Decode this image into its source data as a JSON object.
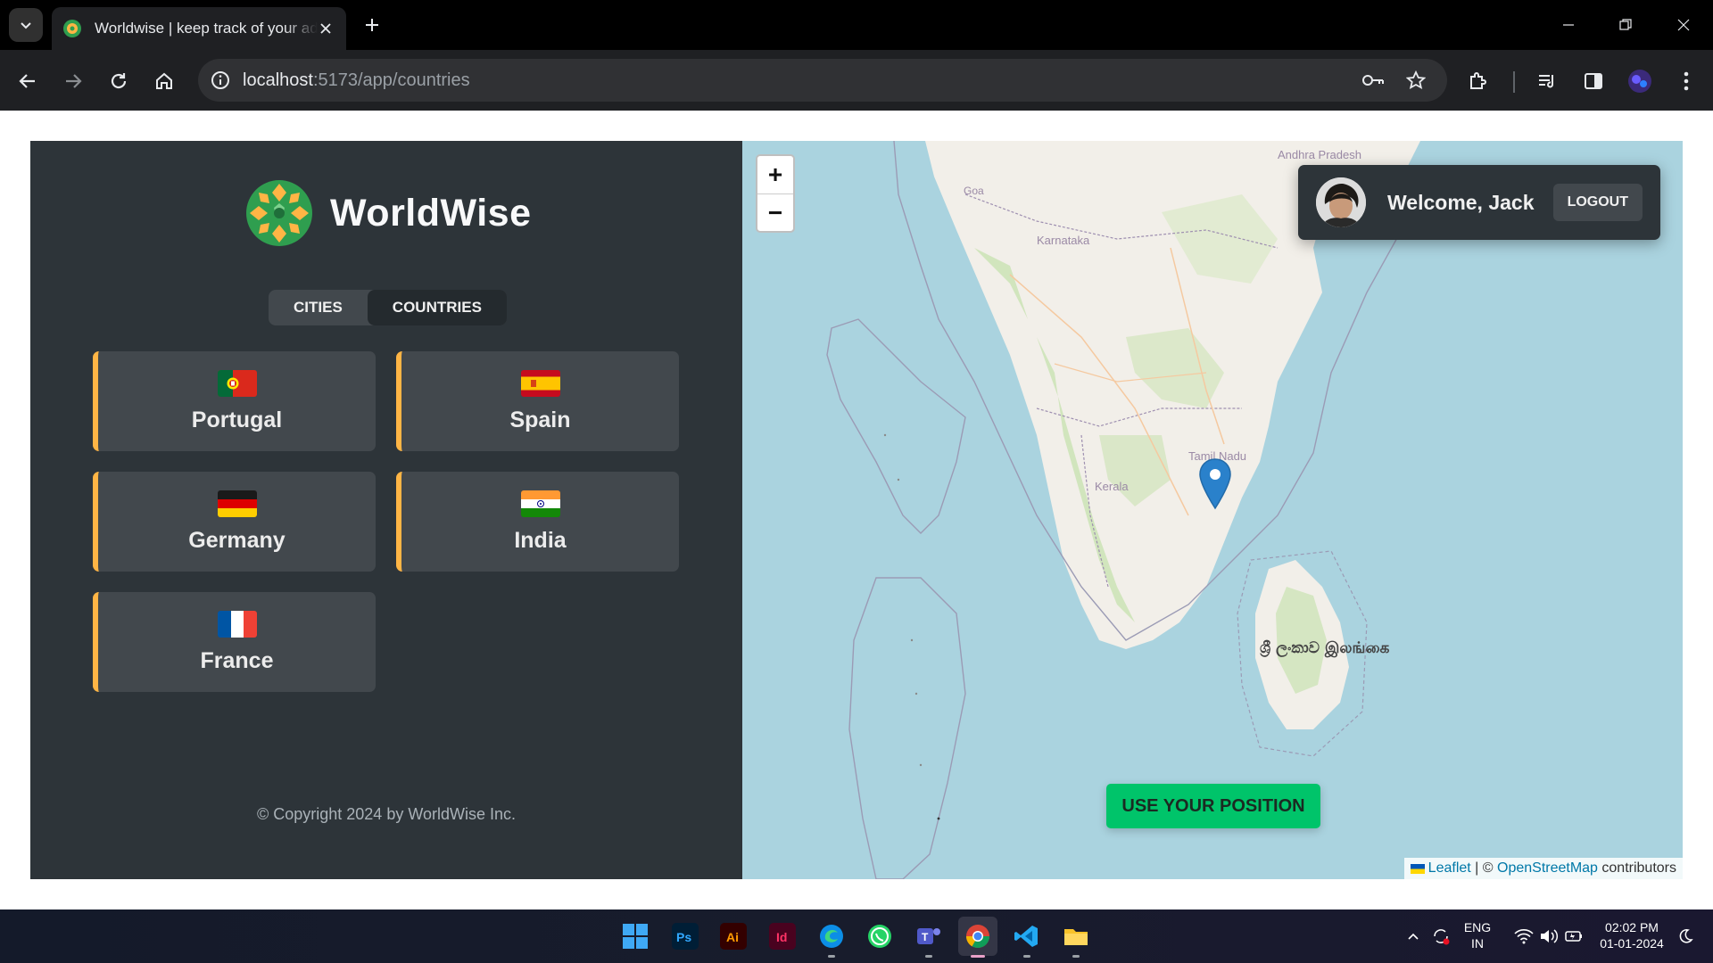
{
  "browser": {
    "tab_title": "Worldwise | keep track of your adventures",
    "url_host": "localhost",
    "url_rest": ":5173/app/countries"
  },
  "app": {
    "logo_text": "WorldWise",
    "nav": [
      {
        "label": "CITIES",
        "active": false
      },
      {
        "label": "COUNTRIES",
        "active": true
      }
    ],
    "countries": [
      {
        "name": "Portugal",
        "flag": "portugal-flag-icon"
      },
      {
        "name": "Spain",
        "flag": "spain-flag-icon"
      },
      {
        "name": "Germany",
        "flag": "germany-flag-icon"
      },
      {
        "name": "India",
        "flag": "india-flag-icon"
      },
      {
        "name": "France",
        "flag": "france-flag-icon"
      }
    ],
    "copyright": "© Copyright 2024 by WorldWise Inc.",
    "accent_color": "#ffb545",
    "brand_green": "#00c46a"
  },
  "map": {
    "zoom_in": "+",
    "zoom_out": "−",
    "labels": {
      "andhra": "Andhra Pradesh",
      "goa": "Goa",
      "karnataka": "Karnataka",
      "tamil_nadu": "Tamil Nadu",
      "kerala": "Kerala",
      "sri_lanka": "ශ්‍රී ලංකාව இலங்கை"
    },
    "welcome": "Welcome, Jack",
    "logout": "LOGOUT",
    "use_position": "USE YOUR POSITION",
    "attribution": {
      "leaflet": "Leaflet",
      "sep": " | © ",
      "osm": "OpenStreetMap",
      "contributors": " contributors"
    }
  },
  "taskbar": {
    "lang_top": "ENG",
    "lang_bottom": "IN",
    "time": "02:02 PM",
    "date": "01-01-2024"
  }
}
